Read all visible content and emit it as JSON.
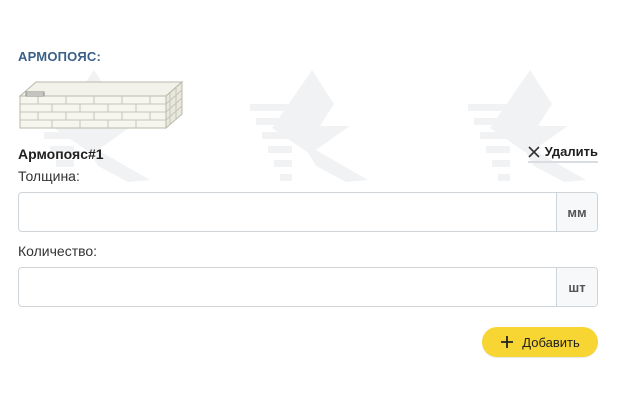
{
  "section": {
    "title": "АРМОПОЯС:"
  },
  "item": {
    "title": "Армопояс#1",
    "delete_label": "Удалить"
  },
  "fields": {
    "thickness": {
      "label": "Толщина:",
      "value": "",
      "placeholder": "",
      "unit": "мм"
    },
    "quantity": {
      "label": "Количество:",
      "value": "",
      "placeholder": "",
      "unit": "шт"
    }
  },
  "actions": {
    "add_label": "Добавить"
  },
  "colors": {
    "section_title": "#3b5f86",
    "accent_button": "#f7d533",
    "input_border": "#cfd4d9"
  },
  "icons": {
    "delete": "close-icon",
    "add": "plus-icon",
    "illustration": "brick-armopoyas-illustration",
    "watermark": "brand-watermark-icon"
  }
}
